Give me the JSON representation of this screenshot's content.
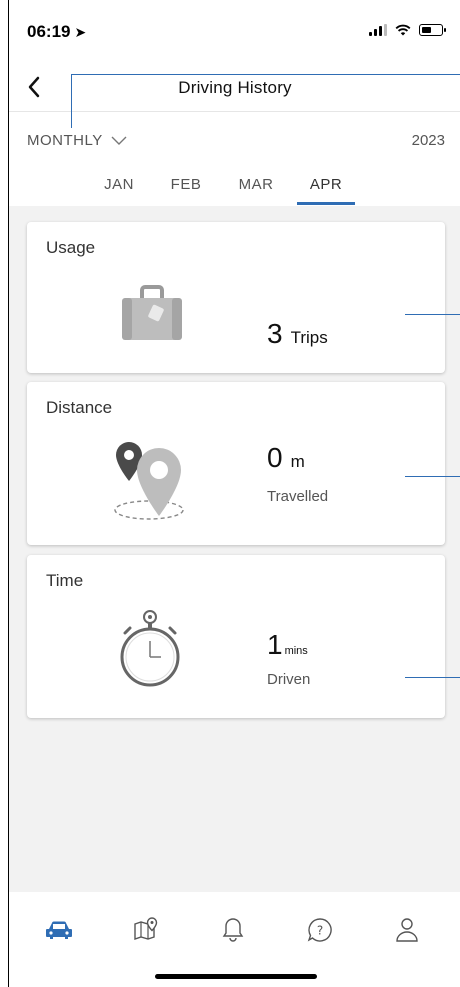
{
  "status_bar": {
    "time": "06:19"
  },
  "header": {
    "title": "Driving History"
  },
  "period": {
    "selected": "MONTHLY",
    "year": "2023"
  },
  "months": [
    {
      "label": "JAN"
    },
    {
      "label": "FEB"
    },
    {
      "label": "MAR"
    },
    {
      "label": "APR",
      "active": true
    }
  ],
  "cards": {
    "usage": {
      "title": "Usage",
      "value": "3",
      "unit": "Trips"
    },
    "distance": {
      "title": "Distance",
      "value": "0",
      "unit": "m",
      "sub": "Travelled"
    },
    "time": {
      "title": "Time",
      "value": "1",
      "unit": "mins",
      "sub": "Driven"
    }
  },
  "tab_bar": {
    "items": [
      {
        "icon": "car-icon",
        "active": true
      },
      {
        "icon": "map-pin-icon"
      },
      {
        "icon": "bell-icon"
      },
      {
        "icon": "help-icon"
      },
      {
        "icon": "profile-icon"
      }
    ]
  },
  "colors": {
    "accent": "#2f6db4",
    "background": "#f2f2f2",
    "icon_gray": "#555555"
  }
}
